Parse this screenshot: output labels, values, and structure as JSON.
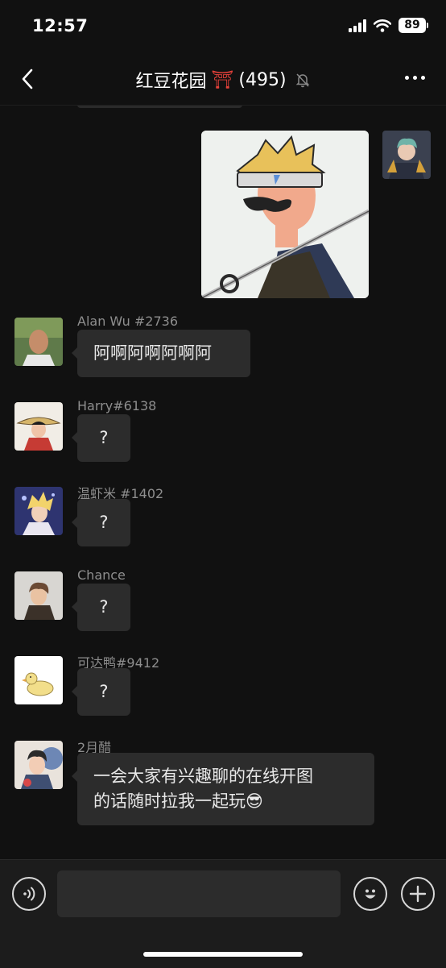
{
  "status_bar": {
    "time": "12:57",
    "battery": "89"
  },
  "header": {
    "title": "红豆花园",
    "torii": "⛩",
    "member_count": "(495)"
  },
  "messages": [
    {
      "sender": "Alan Wu #2736",
      "text": "阿啊阿啊阿啊阿"
    },
    {
      "sender": "Harry#6138",
      "text": "?"
    },
    {
      "sender": "温虾米 #1402",
      "text": "?"
    },
    {
      "sender": "Chance",
      "text": "?"
    },
    {
      "sender": "可达鸭#9412",
      "text": "?"
    },
    {
      "sender": "2月醋",
      "text_line1": "一会大家有兴趣聊的在线开图",
      "text_line2": "的话随时拉我一起玩😎"
    }
  ],
  "input": {
    "value": "",
    "placeholder": ""
  },
  "colors": {
    "background": "#111111",
    "bubble": "#2c2c2c",
    "torii": "#e5413a"
  }
}
